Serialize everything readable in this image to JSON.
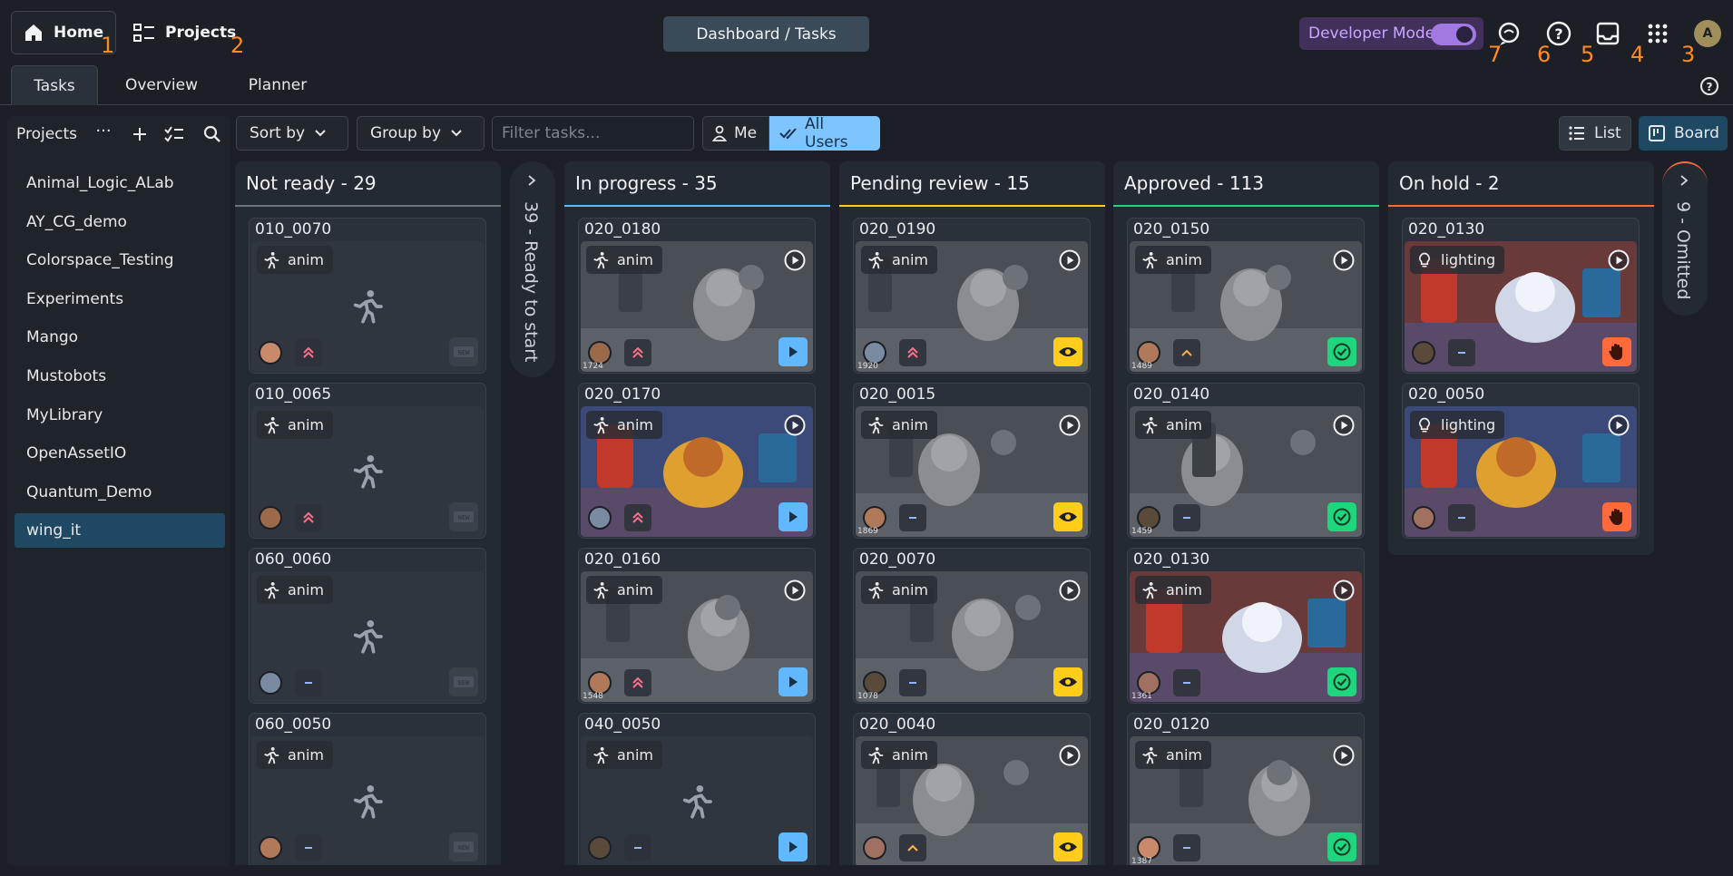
{
  "header": {
    "home_label": "Home",
    "projects_label": "Projects",
    "center_title": "Dashboard / Tasks",
    "dev_mode_label": "Developer Mode",
    "avatar_initial": "A",
    "callouts": [
      "1",
      "2",
      "3",
      "4",
      "5",
      "6",
      "7"
    ]
  },
  "tabs": [
    "Tasks",
    "Overview",
    "Planner"
  ],
  "toolbar": {
    "sort_by": "Sort by",
    "group_by": "Group by",
    "filter_placeholder": "Filter tasks...",
    "me": "Me",
    "all_users": "All Users",
    "list": "List",
    "board": "Board"
  },
  "sidebar": {
    "title": "Projects",
    "more": "···",
    "items": [
      "Animal_Logic_ALab",
      "AY_CG_demo",
      "Colorspace_Testing",
      "Experiments",
      "Mango",
      "Mustobots",
      "MyLibrary",
      "OpenAssetIO",
      "Quantum_Demo",
      "wing_it"
    ],
    "selected": "wing_it"
  },
  "colors": {
    "accent_blue": "#62b8ff",
    "not_ready": "#6b7380",
    "in_progress": "#62b8ff",
    "pending_review": "#ffcd1a",
    "approved": "#1fd67f",
    "on_hold": "#ff6a3d",
    "omitted": "#ff6a3d",
    "callout": "#ff8a1e"
  },
  "board": {
    "collapsed_ready": "39 - Ready to start",
    "collapsed_omitted": "9 - Omitted",
    "columns": [
      {
        "title": "Not ready - 29",
        "cards": [
          {
            "name": "010_0070",
            "task": "anim",
            "priority": "high",
            "status": "not_ready",
            "thumb": "empty"
          },
          {
            "name": "010_0065",
            "task": "anim",
            "priority": "high",
            "status": "not_ready",
            "thumb": "empty"
          },
          {
            "name": "060_0060",
            "task": "anim",
            "priority": "normal",
            "status": "not_ready",
            "thumb": "empty"
          },
          {
            "name": "060_0050",
            "task": "anim",
            "priority": "normal",
            "status": "not_ready",
            "thumb": "empty"
          }
        ]
      },
      {
        "title": "In progress - 35",
        "cards": [
          {
            "name": "020_0180",
            "task": "anim",
            "priority": "high",
            "status": "in_progress",
            "thumb": "gray",
            "frame": "1724"
          },
          {
            "name": "020_0170",
            "task": "anim",
            "priority": "high",
            "status": "in_progress",
            "thumb": "color"
          },
          {
            "name": "020_0160",
            "task": "anim",
            "priority": "high",
            "status": "in_progress",
            "thumb": "gray",
            "frame": "1548"
          },
          {
            "name": "040_0050",
            "task": "anim",
            "priority": "normal",
            "status": "in_progress",
            "thumb": "empty"
          }
        ]
      },
      {
        "title": "Pending review - 15",
        "cards": [
          {
            "name": "020_0190",
            "task": "anim",
            "priority": "high",
            "status": "pending_review",
            "thumb": "gray",
            "frame": "1920"
          },
          {
            "name": "020_0015",
            "task": "anim",
            "priority": "normal",
            "status": "pending_review",
            "thumb": "gray",
            "frame": "1869"
          },
          {
            "name": "020_0070",
            "task": "anim",
            "priority": "normal",
            "status": "pending_review",
            "thumb": "gray",
            "frame": "1078"
          },
          {
            "name": "020_0040",
            "task": "anim",
            "priority": "medium",
            "status": "pending_review",
            "thumb": "gray"
          }
        ]
      },
      {
        "title": "Approved - 113",
        "cards": [
          {
            "name": "020_0150",
            "task": "anim",
            "priority": "medium",
            "status": "approved",
            "thumb": "gray",
            "frame": "1489"
          },
          {
            "name": "020_0140",
            "task": "anim",
            "priority": "normal",
            "status": "approved",
            "thumb": "gray",
            "frame": "1459"
          },
          {
            "name": "020_0130",
            "task": "anim",
            "priority": "normal",
            "status": "approved",
            "thumb": "color",
            "frame": "1361"
          },
          {
            "name": "020_0120",
            "task": "anim",
            "priority": "normal",
            "status": "approved",
            "thumb": "gray",
            "frame": "1387"
          }
        ]
      },
      {
        "title": "On hold - 2",
        "cards": [
          {
            "name": "020_0130",
            "task": "lighting",
            "priority": "normal",
            "status": "on_hold",
            "thumb": "color"
          },
          {
            "name": "020_0050",
            "task": "lighting",
            "priority": "normal",
            "status": "on_hold",
            "thumb": "color"
          }
        ]
      }
    ]
  }
}
